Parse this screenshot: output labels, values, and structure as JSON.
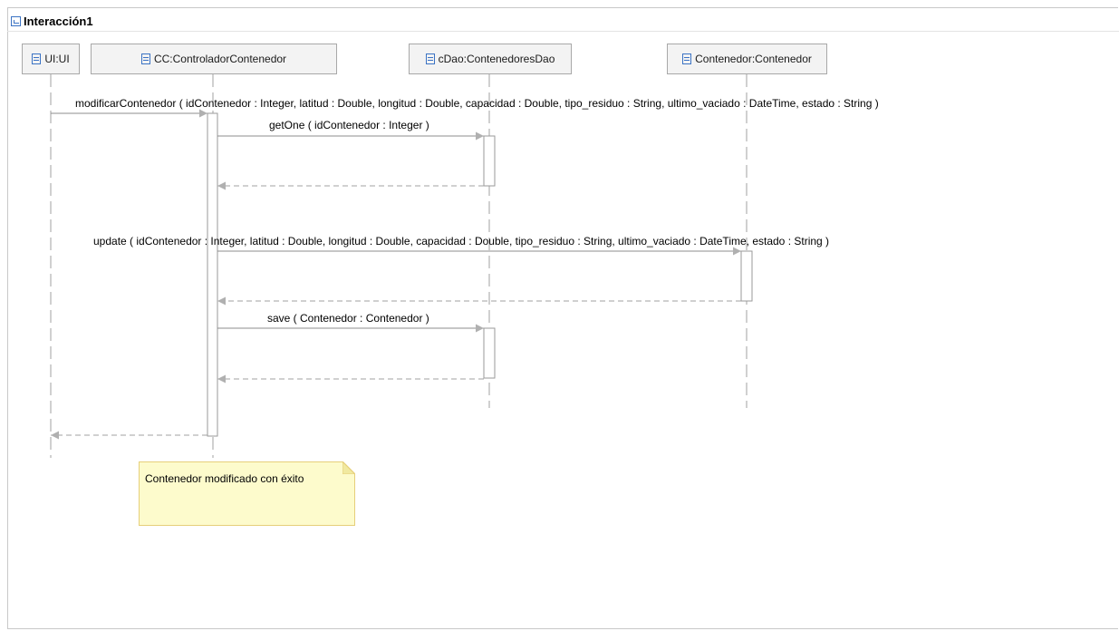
{
  "header": {
    "title": "Interacción1"
  },
  "lifelines": [
    {
      "label": "UI:UI"
    },
    {
      "label": "CC:ControladorContenedor"
    },
    {
      "label": "cDao:ContenedoresDao"
    },
    {
      "label": "Contenedor:Contenedor"
    }
  ],
  "messages": [
    "modificarContenedor ( idContenedor : Integer, latitud : Double, longitud : Double, capacidad : Double, tipo_residuo : String, ultimo_vaciado : DateTime, estado : String )",
    "getOne ( idContenedor : Integer )",
    "update ( idContenedor : Integer, latitud : Double, longitud : Double, capacidad : Double, tipo_residuo : String, ultimo_vaciado : DateTime, estado : String )",
    "save ( Contenedor : Contenedor )"
  ],
  "note": {
    "text": "Contenedor modificado con éxito"
  },
  "colors": {
    "accent": "#3b73c4",
    "note_bg": "#fdfbcc",
    "note_border": "#e6cf7a",
    "arrow": "#a0a0a0"
  }
}
